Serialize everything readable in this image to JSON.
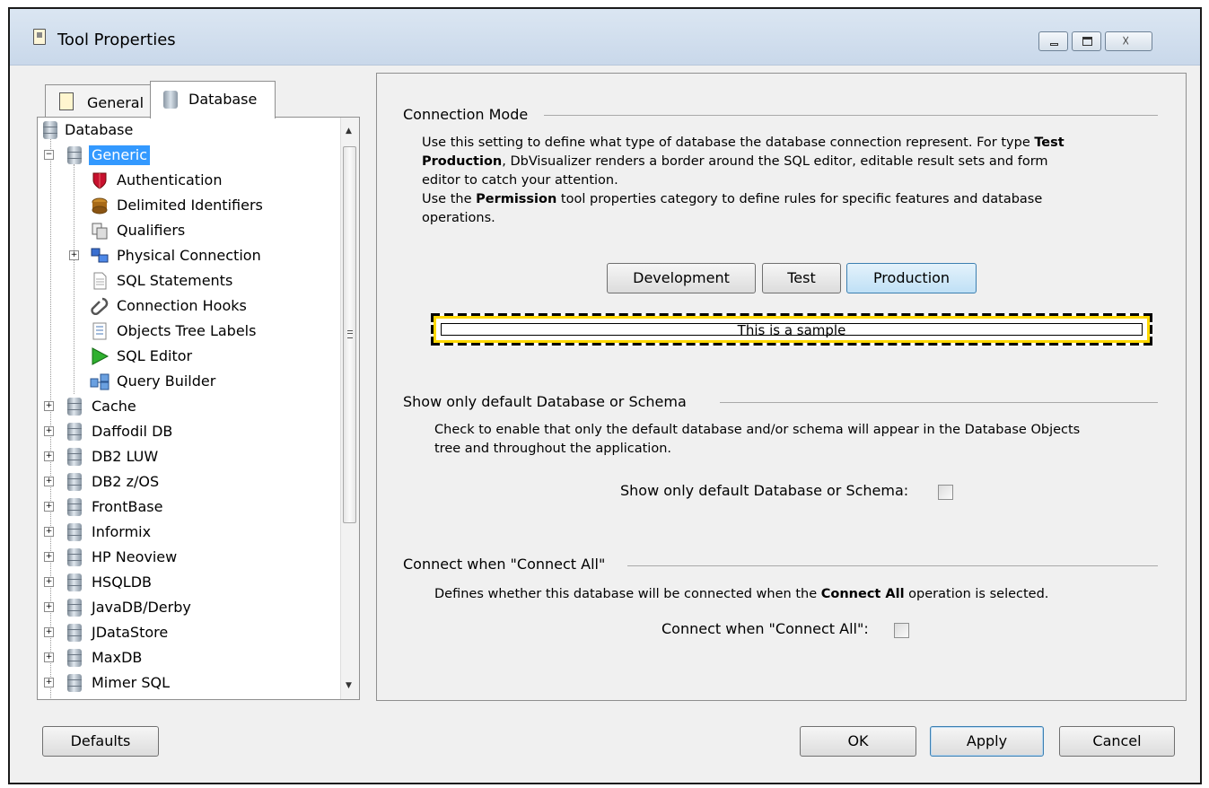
{
  "window": {
    "title": "Tool Properties",
    "minimize_icon": "minimize-icon",
    "maximize_icon": "maximize-icon",
    "close_glyph": "☓"
  },
  "tabs": [
    {
      "label": "General",
      "icon": "properties-icon"
    },
    {
      "label": "Database",
      "icon": "database-icon"
    }
  ],
  "tree": {
    "root": "Database",
    "selected": "Generic",
    "generic_children": [
      {
        "label": "Authentication",
        "icon": "shield-icon"
      },
      {
        "label": "Delimited Identifiers",
        "icon": "coin-stack-icon"
      },
      {
        "label": "Qualifiers",
        "icon": "qualifiers-icon"
      },
      {
        "label": "Physical Connection",
        "icon": "computer-network-icon"
      },
      {
        "label": "SQL Statements",
        "icon": "document-icon"
      },
      {
        "label": "Connection Hooks",
        "icon": "hook-icon"
      },
      {
        "label": "Objects Tree Labels",
        "icon": "tree-labels-icon"
      },
      {
        "label": "SQL Editor",
        "icon": "play-icon"
      },
      {
        "label": "Query Builder",
        "icon": "query-builder-icon"
      }
    ],
    "databases": [
      "Cache",
      "Daffodil DB",
      "DB2 LUW",
      "DB2 z/OS",
      "FrontBase",
      "Informix",
      "HP Neoview",
      "HSQLDB",
      "JavaDB/Derby",
      "JDataStore",
      "MaxDB",
      "Mimer SQL"
    ],
    "scroll_up_glyph": "▲",
    "scroll_down_glyph": "▼"
  },
  "connection_mode": {
    "title": "Connection Mode",
    "line1_pre": "Use this setting to define what type of database the database connection represent. For type ",
    "line1_bold": "Test",
    "line2_bold": "Production",
    "line2_post": ", DbVisualizer renders a border around the SQL editor, editable result sets and form",
    "line3": "editor to catch your attention.",
    "line4_pre": "Use the ",
    "line4_bold": "Permission",
    "line4_post": " tool properties category to define rules for specific features and database",
    "line5": "operations.",
    "buttons": [
      "Development",
      "Test",
      "Production"
    ],
    "selected": "Production",
    "sample_text": "This is a sample",
    "border_colors": {
      "dash": "#000000",
      "stripe": "#ffd800"
    }
  },
  "default_schema": {
    "title": "Show only default Database or Schema",
    "line1": "Check to enable that only the default database and/or schema will appear in the Database Objects",
    "line2": "tree and throughout the application.",
    "checkbox_label": "Show only default Database or Schema:",
    "checked": false
  },
  "connect_all": {
    "title": "Connect when \"Connect All\"",
    "desc_pre": "Defines whether this database will be connected when the ",
    "desc_bold": "Connect All",
    "desc_post": " operation is selected.",
    "checkbox_label": "Connect when \"Connect All\":",
    "checked": false
  },
  "footer": {
    "defaults": "Defaults",
    "ok": "OK",
    "apply": "Apply",
    "cancel": "Cancel"
  },
  "colors": {
    "selection": "#3399ff",
    "accent_button": "#bfe0f6"
  }
}
